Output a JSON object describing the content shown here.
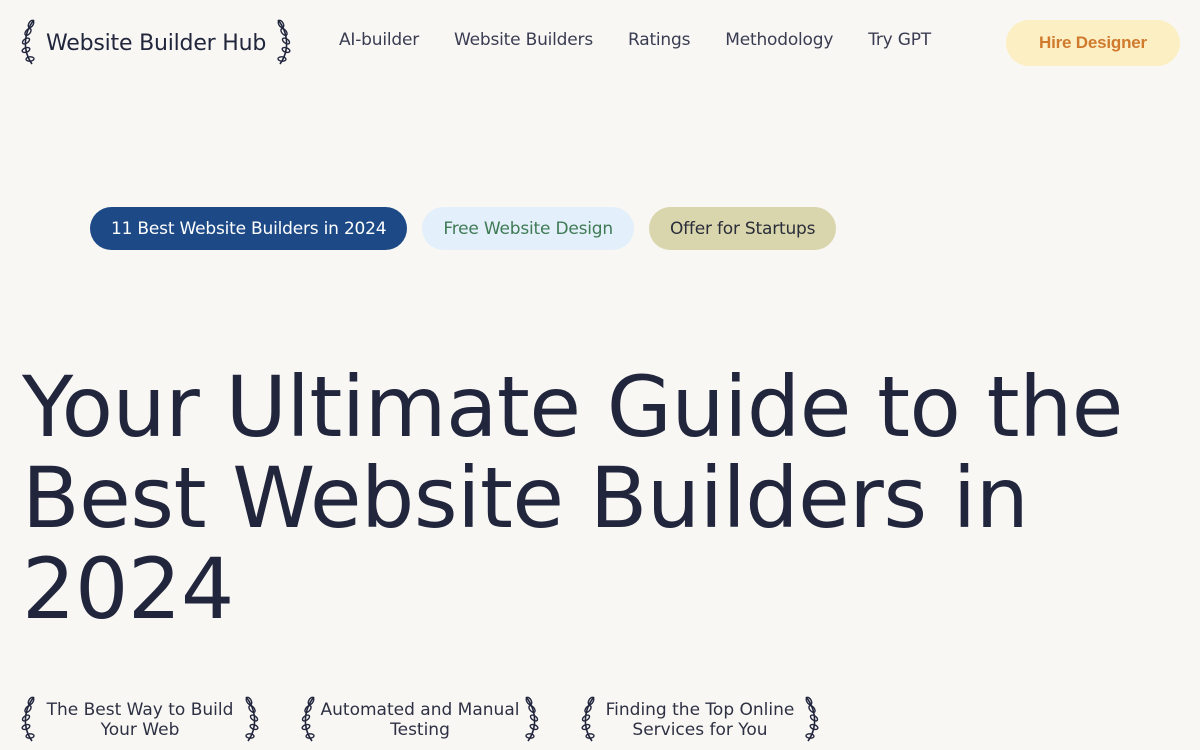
{
  "header": {
    "logo": "Website Builder Hub",
    "nav": [
      "AI-builder",
      "Website Builders",
      "Ratings",
      "Methodology",
      "Try GPT"
    ],
    "cta": "Hire Designer"
  },
  "pills": [
    "11 Best Website Builders in 2024",
    "Free Website Design",
    "Offer for Startups"
  ],
  "hero": {
    "title": "Your Ultimate Guide to the Best Website Builders in 2024"
  },
  "badges": [
    "The Best Way to Build Your Web",
    "Automated and Manual Testing",
    "Finding the Top Online Services for You"
  ],
  "colors": {
    "background": "#f8f7f4",
    "text": "#22263d",
    "cta_bg": "#fcefc3",
    "cta_text": "#d07a2e",
    "pill_primary": "#1d4a86",
    "pill_secondary": "#e3f0fb",
    "pill_tertiary": "#d9d5ac"
  }
}
